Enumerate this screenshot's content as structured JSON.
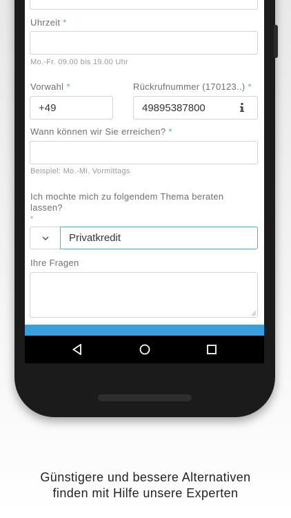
{
  "form": {
    "time": {
      "label": "Uhrzeit",
      "required": "*",
      "value": "",
      "hint": "Mo.-Fr. 09.00 bis 19.00 Uhr"
    },
    "prefix": {
      "label": "Vorwahl",
      "required": "*",
      "value": "+49"
    },
    "callback": {
      "label": "Rückrufnummer (170123..)",
      "required": "*",
      "value": "49895387800",
      "info_icon": "info-icon"
    },
    "reach": {
      "label": "Wann können wir Sie erreichen?",
      "required": "*",
      "value": "",
      "hint": "Beispiel: Mo.-Mi. Vormittags"
    },
    "topic": {
      "label": "Ich mochte mich zu folgendem Thema beraten lassen?",
      "required": "*",
      "selected": "Privatkredit",
      "toggle_icon": "chevron-down-icon"
    },
    "questions": {
      "label": "Ihre Fragen",
      "value": ""
    }
  },
  "android_nav": {
    "back_icon": "back-triangle-icon",
    "home_icon": "home-circle-icon",
    "recents_icon": "recents-square-icon"
  },
  "colors": {
    "accent": "#4fb0c6",
    "submit_bar": "#3a9fda"
  },
  "caption": {
    "line1": "Günstigere und bessere Alternativen",
    "line2": "finden mit Hilfe unsere Experten"
  }
}
